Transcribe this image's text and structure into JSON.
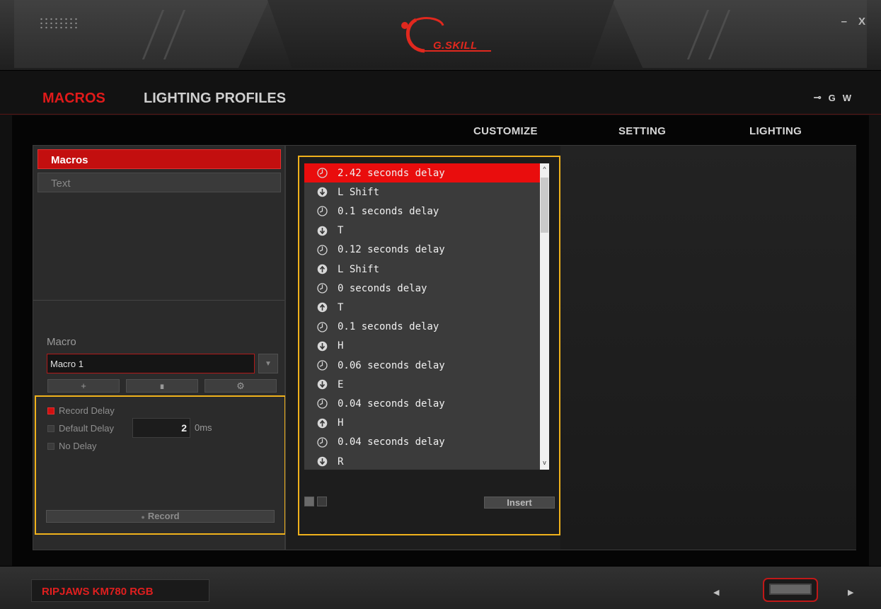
{
  "window": {
    "brand": "G.SKILL",
    "minimize_label": "–",
    "close_label": "X"
  },
  "nav": {
    "tabs": [
      {
        "label": "MACROS",
        "active": true
      },
      {
        "label": "LIGHTING PROFILES",
        "active": false
      }
    ],
    "right_icons": [
      "usb-icon",
      "G",
      "W"
    ],
    "usb_glyph": "⊸",
    "g_label": "G",
    "w_label": "W"
  },
  "subnav": {
    "tabs": [
      {
        "label": "CUSTOMIZE"
      },
      {
        "label": "SETTING"
      },
      {
        "label": "LIGHTING"
      }
    ]
  },
  "left": {
    "categories": [
      {
        "label": "Macros",
        "selected": true
      },
      {
        "label": "Text",
        "selected": false
      }
    ],
    "macro_label": "Macro",
    "macro_value": "Macro 1",
    "dropdown_glyph": "▼",
    "buttons": {
      "add": "+",
      "delete": "∎",
      "settings": "⚙"
    },
    "options": {
      "record_delay": {
        "label": "Record Delay",
        "checked": true
      },
      "default_delay": {
        "label": "Default Delay",
        "checked": false,
        "value": "2",
        "suffix": "0ms"
      },
      "no_delay": {
        "label": "No Delay",
        "checked": false
      }
    },
    "record_label": "Record",
    "record_glyph": "●"
  },
  "sequence": {
    "items": [
      {
        "type": "delay",
        "text": "2.42 seconds delay",
        "selected": true
      },
      {
        "type": "keydown",
        "text": "L Shift"
      },
      {
        "type": "delay",
        "text": "0.1 seconds delay"
      },
      {
        "type": "keydown",
        "text": "T"
      },
      {
        "type": "delay",
        "text": "0.12 seconds delay"
      },
      {
        "type": "keyup",
        "text": "L Shift"
      },
      {
        "type": "delay",
        "text": "0 seconds delay"
      },
      {
        "type": "keyup",
        "text": "T"
      },
      {
        "type": "delay",
        "text": "0.1 seconds delay"
      },
      {
        "type": "keydown",
        "text": "H"
      },
      {
        "type": "delay",
        "text": "0.06 seconds delay"
      },
      {
        "type": "keydown",
        "text": "E"
      },
      {
        "type": "delay",
        "text": "0.04 seconds delay"
      },
      {
        "type": "keyup",
        "text": "H"
      },
      {
        "type": "delay",
        "text": "0.04 seconds delay"
      },
      {
        "type": "keydown",
        "text": "R"
      }
    ],
    "insert_label": "Insert",
    "scroll_up": "^",
    "scroll_down": "v"
  },
  "footer": {
    "device_name": "RIPJAWS KM780 RGB",
    "prev_glyph": "◀",
    "next_glyph": "▶"
  },
  "colors": {
    "accent": "#e01a1a",
    "highlight": "#f0b21c",
    "selected_row": "#e90d0d"
  }
}
